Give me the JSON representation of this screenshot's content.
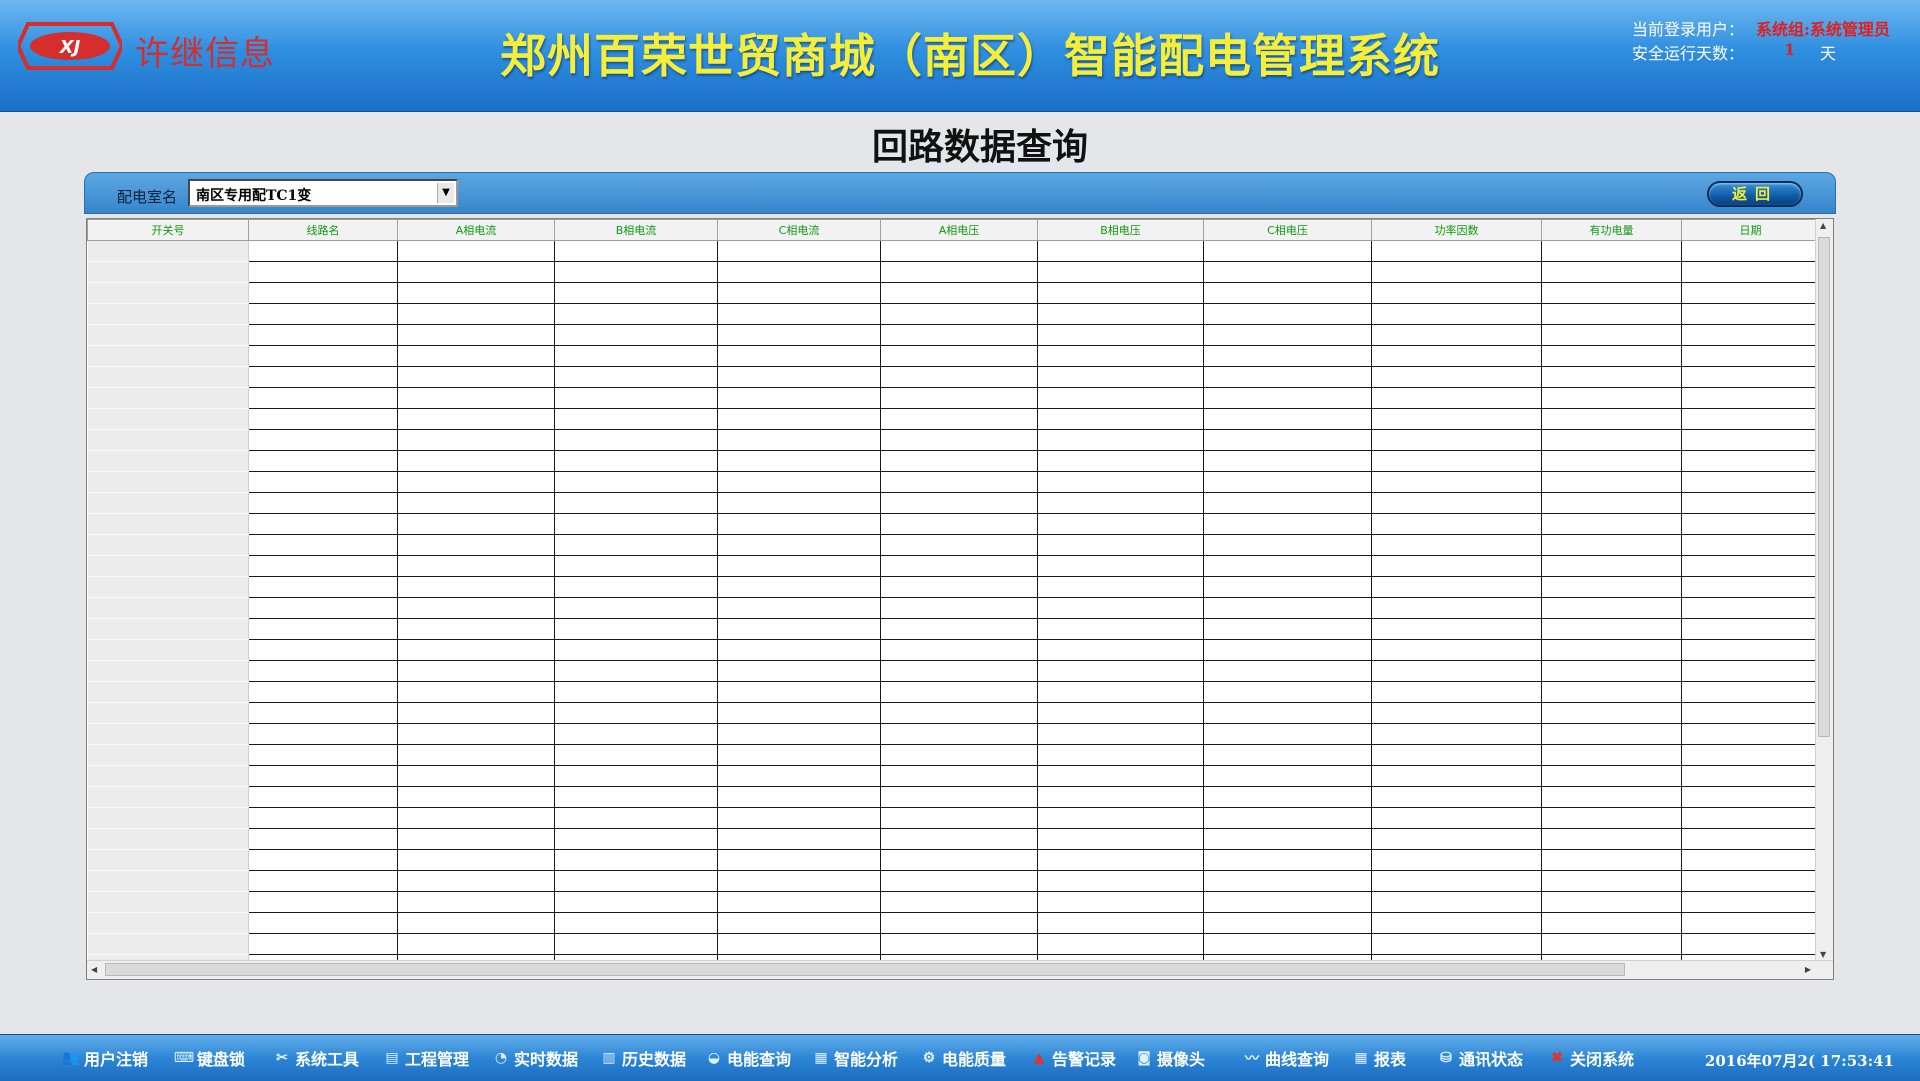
{
  "header": {
    "company_name": "许继信息",
    "system_title": "郑州百荣世贸商城（南区）智能配电管理系统",
    "login_label": "当前登录用户：",
    "login_value": "系统组:系统管理员",
    "days_label": "安全运行天数：",
    "days_value": "1",
    "days_unit": "天"
  },
  "page": {
    "title": "回路数据查询"
  },
  "filter": {
    "room_label": "配电室名",
    "room_value": "南区专用配TC1变",
    "back_label": "返回"
  },
  "grid": {
    "columns": [
      "开关号",
      "线路名",
      "A相电流",
      "B相电流",
      "C相电流",
      "A相电压",
      "B相电压",
      "C相电压",
      "功率因数",
      "有功电量",
      "日期"
    ],
    "visible_row_count": 35
  },
  "taskbar": {
    "items": [
      {
        "label": "用户注销",
        "icon": "users-icon"
      },
      {
        "label": "键盘锁",
        "icon": "keyboard-lock-icon"
      },
      {
        "label": "系统工具",
        "icon": "tools-icon"
      },
      {
        "label": "工程管理",
        "icon": "project-icon"
      },
      {
        "label": "实时数据",
        "icon": "realtime-data-icon"
      },
      {
        "label": "历史数据",
        "icon": "history-data-icon"
      },
      {
        "label": "电能查询",
        "icon": "energy-query-icon"
      },
      {
        "label": "智能分析",
        "icon": "analysis-icon"
      },
      {
        "label": "电能质量",
        "icon": "power-quality-icon"
      },
      {
        "label": "告警记录",
        "icon": "alarm-icon"
      },
      {
        "label": "摄像头",
        "icon": "camera-icon"
      },
      {
        "label": "曲线查询",
        "icon": "curve-icon"
      },
      {
        "label": "报表",
        "icon": "report-icon"
      },
      {
        "label": "通讯状态",
        "icon": "network-icon"
      },
      {
        "label": "关闭系统",
        "icon": "close-system-icon"
      }
    ],
    "datetime": "2016年07月2( 17:53:41"
  },
  "colors": {
    "header_gradient_top": "#6fb7f0",
    "header_gradient_bottom": "#1a6fc6",
    "title_yellow": "#f5ee3a",
    "company_red": "#d62d2d",
    "column_header_green": "#0f9a0f"
  }
}
